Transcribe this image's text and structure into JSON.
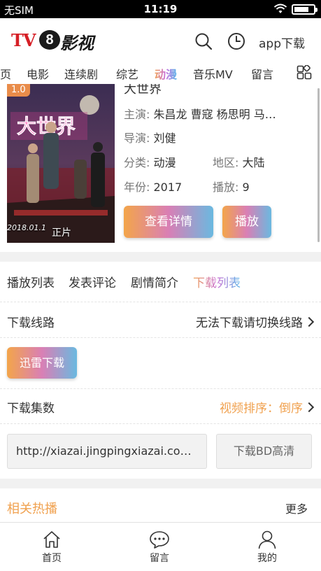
{
  "status_bar": {
    "carrier": "无SIM",
    "time": "11:19"
  },
  "header": {
    "logo": {
      "prefix": "TV",
      "number": "8",
      "cn": "影视"
    },
    "search_icon": "search-icon",
    "history_icon": "clock-icon",
    "app_download": "app下载"
  },
  "nav": {
    "tabs": [
      "页",
      "电影",
      "连续剧",
      "综艺",
      "动漫",
      "音乐MV",
      "留言"
    ],
    "active": "动漫",
    "grid_icon": "grid-icon"
  },
  "movie": {
    "rating": "1.0",
    "title_partial": "大世界",
    "poster_quality": "正片",
    "poster_date": "2018.01.1",
    "actors_label": "主演:",
    "actors": "朱昌龙 曹寇 杨思明 马…",
    "director_label": "导演:",
    "director": "刘健",
    "category_label": "分类:",
    "category": "动漫",
    "region_label": "地区:",
    "region": "大陆",
    "year_label": "年份:",
    "year": "2017",
    "plays_label": "播放:",
    "plays": "9",
    "details_button": "查看详情",
    "play_button": "播放"
  },
  "section_tabs": [
    "播放列表",
    "发表评论",
    "剧情简介",
    "下载列表"
  ],
  "section_active": "下载列表",
  "download": {
    "route_label": "下载线路",
    "route_value": "无法下载请切换线路",
    "thunder_button": "迅雷下载",
    "episodes_label": "下载集数",
    "sort_label": "视频排序：倒序",
    "url": "http://xiazai.jingpingxiazai.co…",
    "bd_button": "下载BD高清"
  },
  "related": {
    "title": "相关热播",
    "more": "更多"
  },
  "bottom_nav": [
    {
      "label": "首页",
      "icon": "home-icon"
    },
    {
      "label": "留言",
      "icon": "chat-icon"
    },
    {
      "label": "我的",
      "icon": "user-icon"
    }
  ],
  "colors": {
    "accent_orange": "#f0a14f",
    "accent_blue": "#6ab9e0",
    "accent_pink": "#d97fb5"
  }
}
